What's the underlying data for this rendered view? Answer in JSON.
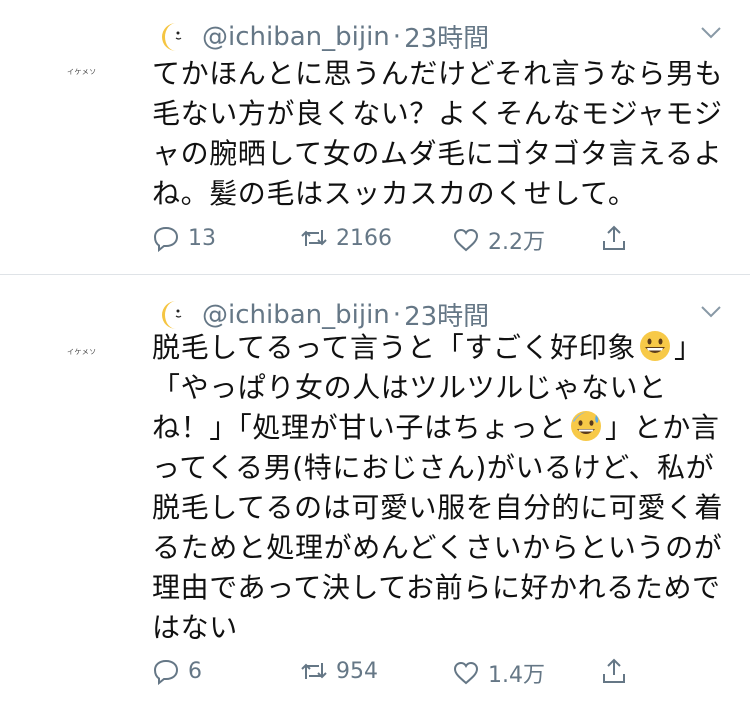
{
  "tweets": [
    {
      "avatar_text": "イケメソ",
      "handle": "@ichiban_bijin",
      "separator": "·",
      "time": "23時間",
      "text": "てかほんとに思うんだけどそれ言うなら男も毛ない方が良くない？よくそんなモジャモジャの腕晒して女のムダ毛にゴタゴタ言えるよね。髪の毛はスッカスカのくせして。",
      "replies": "13",
      "retweets": "2166",
      "likes": "2.2万"
    },
    {
      "avatar_text": "イケメソ",
      "handle": "@ichiban_bijin",
      "separator": "·",
      "time": "23時間",
      "text_part1": "脱毛してるって言うと「すごく好印象",
      "text_part2": "」\n「やっぱり女の人はツルツルじゃないとね！」「処理が甘い子はちょっと",
      "text_part3": "」とか言ってくる男(特におじさん)がいるけど、私が脱毛してるのは可愛い服を自分的に可愛く着るためと処理がめんどくさいからというのが理由であって決してお前らに好かれるためではない",
      "replies": "6",
      "retweets": "954",
      "likes": "1.4万"
    }
  ],
  "icons": {
    "moon": "crescent-moon-emoji",
    "grin": "grinning-face-emoji",
    "sweat": "grinning-face-with-sweat-emoji",
    "reply": "reply-icon",
    "retweet": "retweet-icon",
    "like": "heart-icon",
    "share": "share-icon",
    "more": "chevron-down-icon"
  },
  "colors": {
    "meta_gray": "#657786",
    "text": "#111111",
    "divider": "#dfe3e7"
  }
}
